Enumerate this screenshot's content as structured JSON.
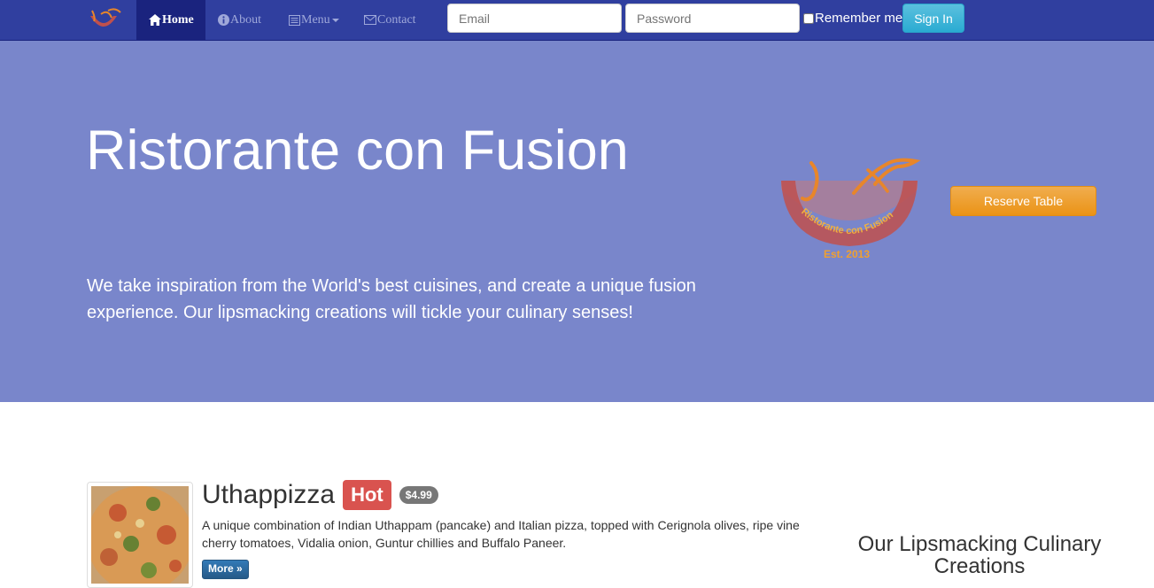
{
  "navbar": {
    "items": [
      {
        "label": "Home",
        "icon": "home-icon",
        "active": true
      },
      {
        "label": "About",
        "icon": "info-icon"
      },
      {
        "label": "Menu",
        "icon": "list-icon"
      },
      {
        "label": "Contact",
        "icon": "envelope-icon"
      }
    ],
    "login": {
      "email_placeholder": "Email",
      "password_placeholder": "Password",
      "remember_label": "Remember me",
      "signin_label": "Sign In"
    }
  },
  "hero": {
    "title": "Ristorante con Fusion",
    "text": "We take inspiration from the World's best cuisines, and create a unique fusion experience. Our lipsmacking creations will tickle your culinary senses!",
    "logo_text": "Ristorante con Fusion",
    "logo_est": "Est. 2013",
    "reserve_label": "Reserve Table"
  },
  "dish": {
    "name": "Uthappizza",
    "label": "Hot",
    "price": "$4.99",
    "description": "A unique combination of Indian Uthappam (pancake) and Italian pizza, topped with Cerignola olives, ripe vine cherry tomatoes, Vidalia onion, Guntur chillies and Buffalo Paneer.",
    "more_label": "More »"
  },
  "side": {
    "heading": "Our Lipsmacking Culinary Creations"
  },
  "colors": {
    "navbar": "#303F9F",
    "navbar_active": "#1A237E",
    "jumbotron": "#7986CB",
    "reserve": "#F0AD4E",
    "signin": "#5BC0DE",
    "hot": "#D9534F"
  }
}
